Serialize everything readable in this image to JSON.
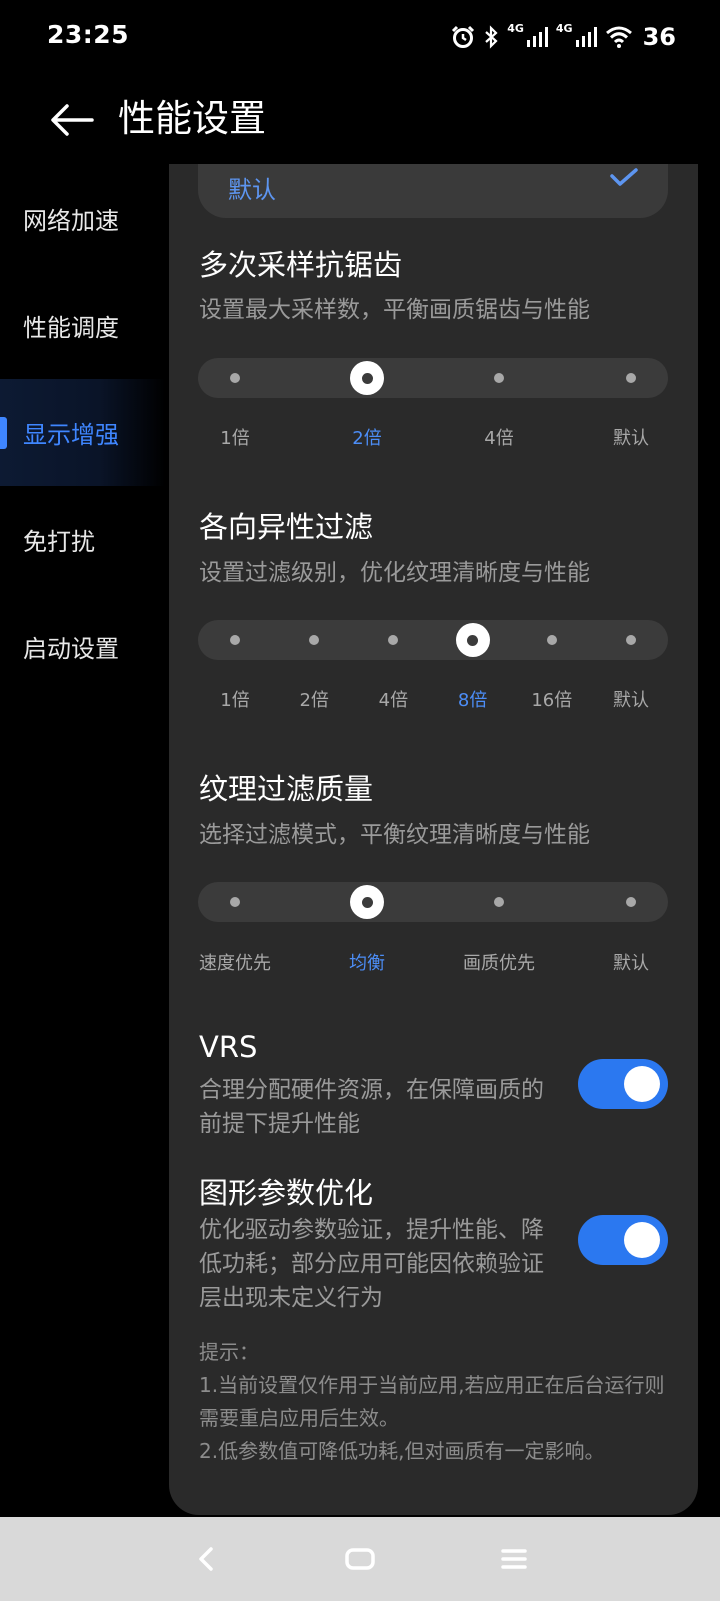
{
  "status_bar": {
    "time": "23:25",
    "battery": "36",
    "signal_1": "4G",
    "signal_2": "4G"
  },
  "header": {
    "title": "性能设置"
  },
  "sidebar": {
    "items": [
      {
        "label": "网络加速"
      },
      {
        "label": "性能调度"
      },
      {
        "label": "显示增强"
      },
      {
        "label": "免打扰"
      },
      {
        "label": "启动设置"
      }
    ],
    "active_index": 2
  },
  "default_option": {
    "label": "默认",
    "selected": true
  },
  "msaa": {
    "title": "多次采样抗锯齿",
    "desc": "设置最大采样数，平衡画质锯齿与性能",
    "options": [
      "1倍",
      "2倍",
      "4倍",
      "默认"
    ],
    "selected_index": 1
  },
  "anisotropic": {
    "title": "各向异性过滤",
    "desc": "设置过滤级别，优化纹理清晰度与性能",
    "options": [
      "1倍",
      "2倍",
      "4倍",
      "8倍",
      "16倍",
      "默认"
    ],
    "selected_index": 3
  },
  "texture_filter": {
    "title": "纹理过滤质量",
    "desc": "选择过滤模式，平衡纹理清晰度与性能",
    "options": [
      "速度优先",
      "均衡",
      "画质优先",
      "默认"
    ],
    "selected_index": 1
  },
  "vrs": {
    "title": "VRS",
    "desc": "合理分配硬件资源，在保障画质的前提下提升性能",
    "enabled": true
  },
  "graphics_opt": {
    "title": "图形参数优化",
    "desc": "优化驱动参数验证，提升性能、降低功耗；部分应用可能因依赖验证层出现未定义行为",
    "enabled": true
  },
  "tips": {
    "heading": "提示：",
    "line1": "1.当前设置仅作用于当前应用,若应用正在后台运行则需要重启应用后生效。",
    "line2": "2.低参数值可降低功耗,但对画质有一定影响。"
  },
  "colors": {
    "accent": "#3f86ff",
    "toggle_on": "#2b78f0",
    "panel": "#2a2a2a",
    "track": "#3b3b3b"
  },
  "icons": {
    "back": "arrow-left-icon",
    "check": "checkmark-icon",
    "nav_back": "chevron-left-icon",
    "nav_home": "home-icon",
    "nav_menu": "menu-icon"
  }
}
